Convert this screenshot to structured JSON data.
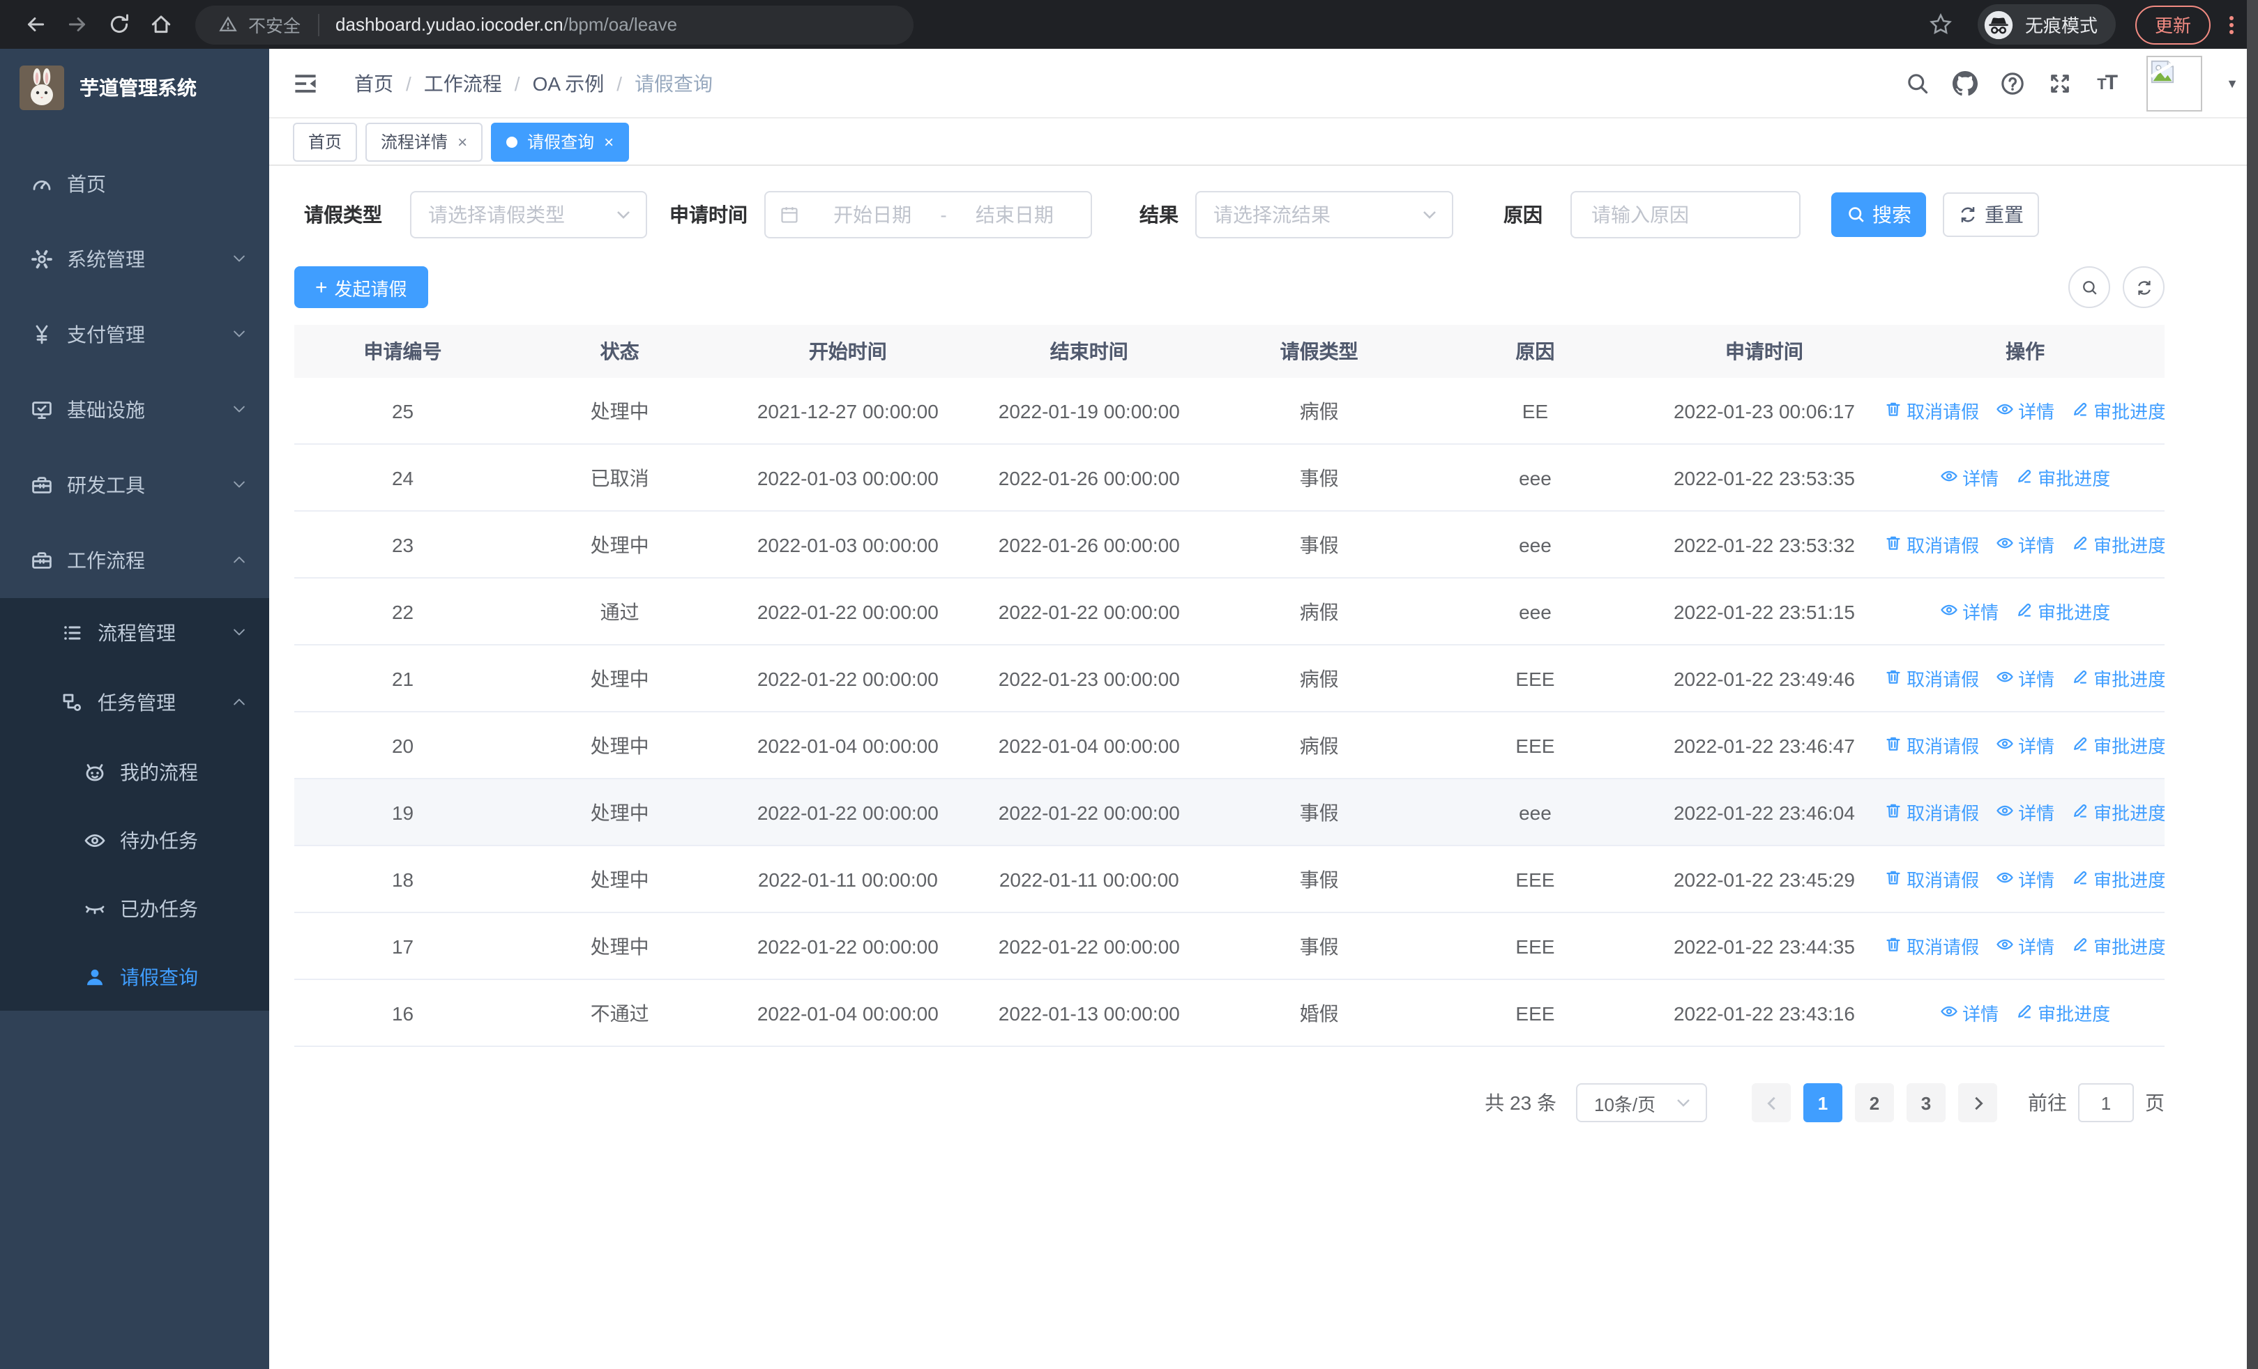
{
  "browser": {
    "nav_icons": [
      {
        "name": "back-icon",
        "dim": false
      },
      {
        "name": "forward-icon",
        "dim": true
      },
      {
        "name": "reload-icon",
        "dim": false
      },
      {
        "name": "home-icon",
        "dim": false
      }
    ],
    "not_secure": "不安全",
    "host": "dashboard.yudao.iocoder.cn",
    "path": "/bpm/oa/leave",
    "incognito_label": "无痕模式",
    "update_label": "更新"
  },
  "sidebar": {
    "app_title": "芋道管理系统",
    "items": [
      {
        "label": "首页",
        "icon": "dashboard-icon"
      },
      {
        "label": "系统管理",
        "icon": "gear-icon",
        "chevron": "down"
      },
      {
        "label": "支付管理",
        "icon": "yen-icon",
        "chevron": "down"
      },
      {
        "label": "基础设施",
        "icon": "monitor-icon",
        "chevron": "down"
      },
      {
        "label": "研发工具",
        "icon": "toolbox-icon",
        "chevron": "down"
      },
      {
        "label": "工作流程",
        "icon": "toolbox-icon",
        "chevron": "up",
        "children": [
          {
            "label": "流程管理",
            "icon": "list-tree-icon",
            "chevron": "down"
          },
          {
            "label": "任务管理",
            "icon": "workflow-icon",
            "chevron": "up",
            "children": [
              {
                "label": "我的流程",
                "icon": "robot-icon"
              },
              {
                "label": "待办任务",
                "icon": "eye-icon"
              },
              {
                "label": "已办任务",
                "icon": "eye-closed-icon"
              },
              {
                "label": "请假查询",
                "icon": "user-icon",
                "active": true
              }
            ]
          }
        ]
      }
    ]
  },
  "breadcrumb": [
    "首页",
    "工作流程",
    "OA 示例",
    "请假查询"
  ],
  "header_icons": [
    {
      "name": "search-icon"
    },
    {
      "name": "github-icon"
    },
    {
      "name": "question-icon"
    },
    {
      "name": "fullscreen-icon"
    },
    {
      "name": "font-size-icon"
    }
  ],
  "tabs": [
    {
      "label": "首页",
      "closable": false,
      "active": false
    },
    {
      "label": "流程详情",
      "closable": true,
      "active": false
    },
    {
      "label": "请假查询",
      "closable": true,
      "active": true
    }
  ],
  "filters": {
    "leave_type_label": "请假类型",
    "leave_type_placeholder": "请选择请假类型",
    "apply_time_label": "申请时间",
    "start_placeholder": "开始日期",
    "range_separator": "-",
    "end_placeholder": "结束日期",
    "result_label": "结果",
    "result_placeholder": "请选择流结果",
    "reason_label": "原因",
    "reason_placeholder": "请输入原因",
    "search_label": "搜索",
    "reset_label": "重置"
  },
  "toolbar": {
    "create_label": "发起请假"
  },
  "table": {
    "columns": [
      "申请编号",
      "状态",
      "开始时间",
      "结束时间",
      "请假类型",
      "原因",
      "申请时间",
      "操作"
    ],
    "action_labels": {
      "cancel": "取消请假",
      "detail": "详情",
      "progress": "审批进度"
    },
    "rows": [
      {
        "id": "25",
        "status": "处理中",
        "start": "2021-12-27 00:00:00",
        "end": "2022-01-19 00:00:00",
        "type": "病假",
        "reason": "EE",
        "apply_time": "2022-01-23 00:06:17",
        "actions": [
          {
            "label": "取消请假",
            "icon": "trash-icon"
          },
          {
            "label": "详情",
            "icon": "eye-icon"
          },
          {
            "label": "审批进度",
            "icon": "edit-icon"
          }
        ],
        "highlighted": false
      },
      {
        "id": "24",
        "status": "已取消",
        "start": "2022-01-03 00:00:00",
        "end": "2022-01-26 00:00:00",
        "type": "事假",
        "reason": "eee",
        "apply_time": "2022-01-22 23:53:35",
        "actions": [
          {
            "label": "详情",
            "icon": "eye-icon"
          },
          {
            "label": "审批进度",
            "icon": "edit-icon"
          }
        ],
        "highlighted": false
      },
      {
        "id": "23",
        "status": "处理中",
        "start": "2022-01-03 00:00:00",
        "end": "2022-01-26 00:00:00",
        "type": "事假",
        "reason": "eee",
        "apply_time": "2022-01-22 23:53:32",
        "actions": [
          {
            "label": "取消请假",
            "icon": "trash-icon"
          },
          {
            "label": "详情",
            "icon": "eye-icon"
          },
          {
            "label": "审批进度",
            "icon": "edit-icon"
          }
        ],
        "highlighted": false
      },
      {
        "id": "22",
        "status": "通过",
        "start": "2022-01-22 00:00:00",
        "end": "2022-01-22 00:00:00",
        "type": "病假",
        "reason": "eee",
        "apply_time": "2022-01-22 23:51:15",
        "actions": [
          {
            "label": "详情",
            "icon": "eye-icon"
          },
          {
            "label": "审批进度",
            "icon": "edit-icon"
          }
        ],
        "highlighted": false
      },
      {
        "id": "21",
        "status": "处理中",
        "start": "2022-01-22 00:00:00",
        "end": "2022-01-23 00:00:00",
        "type": "病假",
        "reason": "EEE",
        "apply_time": "2022-01-22 23:49:46",
        "actions": [
          {
            "label": "取消请假",
            "icon": "trash-icon"
          },
          {
            "label": "详情",
            "icon": "eye-icon"
          },
          {
            "label": "审批进度",
            "icon": "edit-icon"
          }
        ],
        "highlighted": false
      },
      {
        "id": "20",
        "status": "处理中",
        "start": "2022-01-04 00:00:00",
        "end": "2022-01-04 00:00:00",
        "type": "病假",
        "reason": "EEE",
        "apply_time": "2022-01-22 23:46:47",
        "actions": [
          {
            "label": "取消请假",
            "icon": "trash-icon"
          },
          {
            "label": "详情",
            "icon": "eye-icon"
          },
          {
            "label": "审批进度",
            "icon": "edit-icon"
          }
        ],
        "highlighted": false
      },
      {
        "id": "19",
        "status": "处理中",
        "start": "2022-01-22 00:00:00",
        "end": "2022-01-22 00:00:00",
        "type": "事假",
        "reason": "eee",
        "apply_time": "2022-01-22 23:46:04",
        "actions": [
          {
            "label": "取消请假",
            "icon": "trash-icon"
          },
          {
            "label": "详情",
            "icon": "eye-icon"
          },
          {
            "label": "审批进度",
            "icon": "edit-icon"
          }
        ],
        "highlighted": true
      },
      {
        "id": "18",
        "status": "处理中",
        "start": "2022-01-11 00:00:00",
        "end": "2022-01-11 00:00:00",
        "type": "事假",
        "reason": "EEE",
        "apply_time": "2022-01-22 23:45:29",
        "actions": [
          {
            "label": "取消请假",
            "icon": "trash-icon"
          },
          {
            "label": "详情",
            "icon": "eye-icon"
          },
          {
            "label": "审批进度",
            "icon": "edit-icon"
          }
        ],
        "highlighted": false
      },
      {
        "id": "17",
        "status": "处理中",
        "start": "2022-01-22 00:00:00",
        "end": "2022-01-22 00:00:00",
        "type": "事假",
        "reason": "EEE",
        "apply_time": "2022-01-22 23:44:35",
        "actions": [
          {
            "label": "取消请假",
            "icon": "trash-icon"
          },
          {
            "label": "详情",
            "icon": "eye-icon"
          },
          {
            "label": "审批进度",
            "icon": "edit-icon"
          }
        ],
        "highlighted": false
      },
      {
        "id": "16",
        "status": "不通过",
        "start": "2022-01-04 00:00:00",
        "end": "2022-01-13 00:00:00",
        "type": "婚假",
        "reason": "EEE",
        "apply_time": "2022-01-22 23:43:16",
        "actions": [
          {
            "label": "详情",
            "icon": "eye-icon"
          },
          {
            "label": "审批进度",
            "icon": "edit-icon"
          }
        ],
        "highlighted": false
      }
    ]
  },
  "pagination": {
    "total": "共 23 条",
    "page_size": "10条/页",
    "pages": [
      "1",
      "2",
      "3"
    ],
    "active_page": "1",
    "goto_label": "前往",
    "goto_value": "1",
    "unit_label": "页"
  },
  "colors": {
    "primary": "#409eff",
    "sidebar_bg": "#304156",
    "submenu_bg": "#1f2d3d",
    "update_chip": "#f28b82"
  }
}
